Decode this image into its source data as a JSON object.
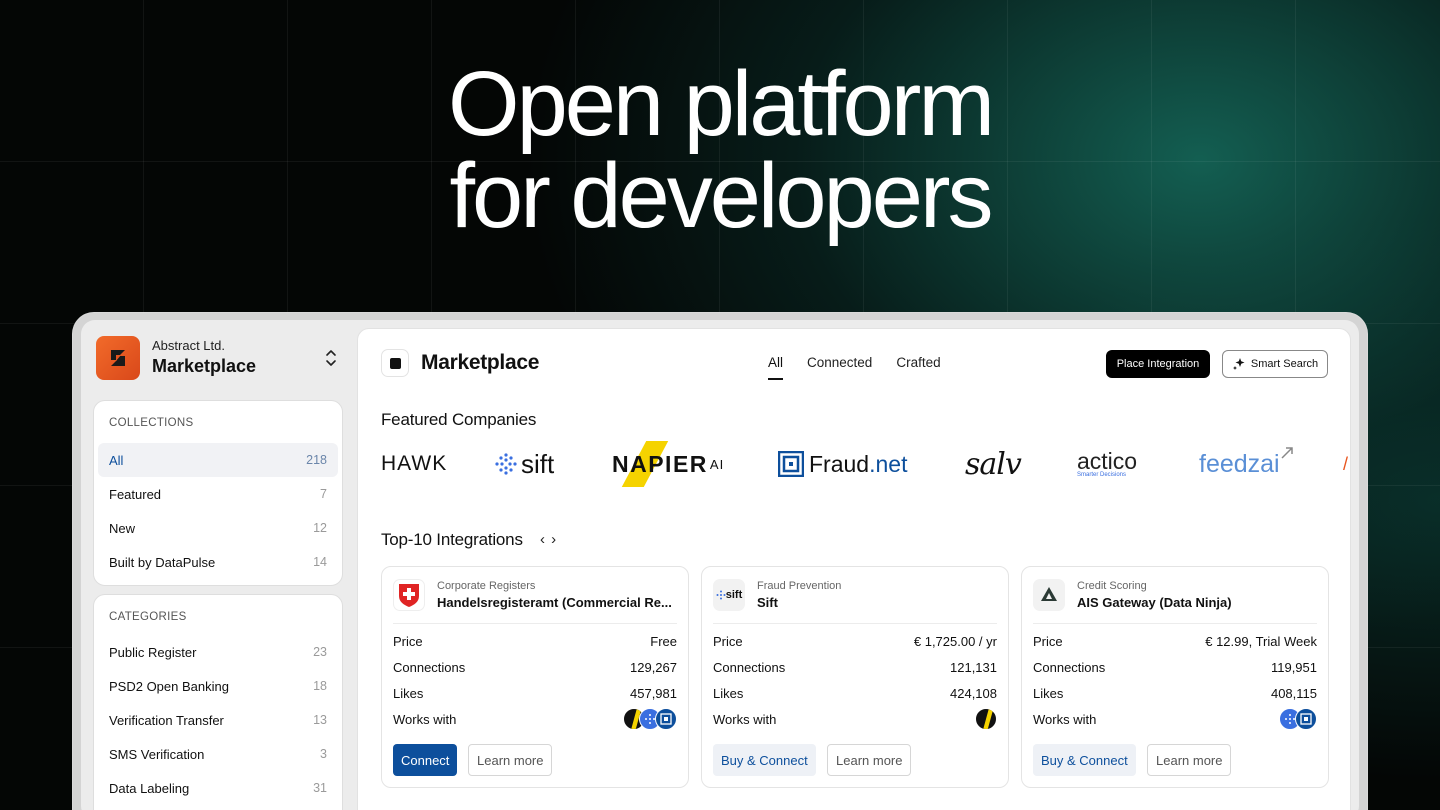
{
  "hero": {
    "line1": "Open platform",
    "line2": "for developers"
  },
  "org": {
    "company": "Abstract Ltd.",
    "product": "Marketplace"
  },
  "collections": {
    "title": "COLLECTIONS",
    "items": [
      {
        "label": "All",
        "count": "218",
        "active": true
      },
      {
        "label": "Featured",
        "count": "7"
      },
      {
        "label": "New",
        "count": "12"
      },
      {
        "label": "Built by DataPulse",
        "count": "14"
      }
    ]
  },
  "categories": {
    "title": "CATEGORIES",
    "items": [
      {
        "label": "Public Register",
        "count": "23"
      },
      {
        "label": "PSD2 Open Banking",
        "count": "18"
      },
      {
        "label": "Verification Transfer",
        "count": "13"
      },
      {
        "label": "SMS Verification",
        "count": "3"
      },
      {
        "label": "Data Labeling",
        "count": "31"
      }
    ]
  },
  "header": {
    "title": "Marketplace",
    "tabs": [
      "All",
      "Connected",
      "Crafted"
    ],
    "active_tab": "All",
    "place_button": "Place Integration",
    "smart_button": "Smart Search"
  },
  "featured": {
    "title": "Featured Companies",
    "logos": [
      {
        "name": "hawk",
        "text": "HAWK"
      },
      {
        "name": "sift",
        "text": "sift"
      },
      {
        "name": "napier",
        "text": "NAPIER",
        "suffix": "AI"
      },
      {
        "name": "fraud-net",
        "text": "Fraud",
        "suffix": ".net"
      },
      {
        "name": "salv",
        "text": "salv"
      },
      {
        "name": "actico",
        "text": "actico",
        "tagline": "Smarter Decisions"
      },
      {
        "name": "feedzai",
        "text": "feedzai"
      }
    ]
  },
  "top": {
    "title": "Top-10 Integrations",
    "nav": "‹ ›"
  },
  "labels": {
    "price": "Price",
    "connections": "Connections",
    "likes": "Likes",
    "works_with": "Works with",
    "learn_more": "Learn more"
  },
  "cards": [
    {
      "category": "Corporate Registers",
      "name": "Handelsregisteramt (Commercial Re...",
      "price": "Free",
      "connections": "129,267",
      "likes": "457,981",
      "action": "Connect",
      "logo_icon": "swiss-cross-icon"
    },
    {
      "category": "Fraud Prevention",
      "name": "Sift",
      "price": "€ 1,725.00 / yr",
      "connections": "121,131",
      "likes": "424,108",
      "action": "Buy & Connect",
      "logo_text": "sift",
      "logo_icon": "sift-logo-icon"
    },
    {
      "category": "Credit Scoring",
      "name": "AIS Gateway (Data Ninja)",
      "price": "€ 12.99, Trial Week",
      "connections": "119,951",
      "likes": "408,115",
      "action": "Buy & Connect",
      "logo_icon": "ais-gateway-logo-icon"
    }
  ],
  "colors": {
    "accent": "#0d4f9c",
    "brand_orange": "#e8561f",
    "napier_yellow": "#f5d300",
    "bg_teal": "#166e5f"
  }
}
